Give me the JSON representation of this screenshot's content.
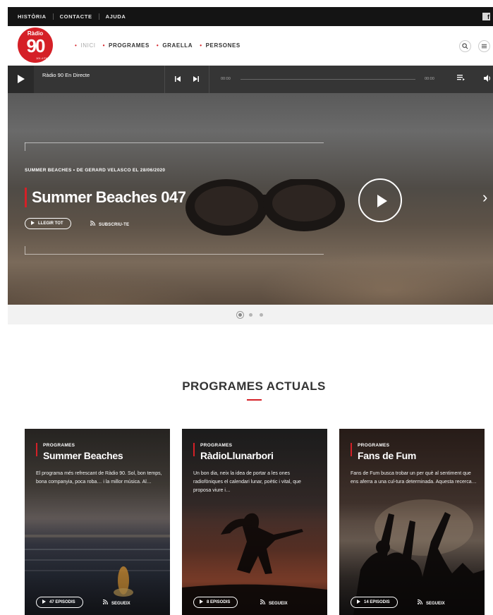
{
  "topbar": {
    "links": [
      "HISTÒRIA",
      "CONTACTE",
      "AJUDA"
    ],
    "social": "f"
  },
  "header": {
    "logo": {
      "top": "Ràdio",
      "number": "90",
      "freq": "101.4 FM"
    },
    "nav": [
      {
        "label": "INICI",
        "active": true
      },
      {
        "label": "PROGRAMES",
        "active": false
      },
      {
        "label": "GRAELLA",
        "active": false
      },
      {
        "label": "PERSONES",
        "active": false
      }
    ],
    "search_icon": "search-icon",
    "menu_icon": "menu-icon"
  },
  "player": {
    "title": "Ràdio 90 En Directe",
    "time_current": "00:00",
    "time_total": "00:00",
    "prev_icon": "⏮",
    "next_icon": "⏭",
    "playlist_icon": "≡",
    "volume_icon": "🔊"
  },
  "hero": {
    "meta": "SUMMER BEACHES • DE GERARD VELASCO EL 28/06/2020",
    "title": "Summer Beaches 047",
    "read_more": "LLEGIR TOT",
    "subscribe": "SUBSCRIU-TE",
    "next_arrow": "›",
    "slides": 3,
    "active_slide": 1
  },
  "section": {
    "title": "PROGRAMES ACTUALS"
  },
  "programs": [
    {
      "category": "PROGRAMES",
      "title": "Summer Beaches",
      "description": "El programa més refrescant de Ràdio 90. Sol, bon temps, bona companyia, poca roba… i la millor música. Al…",
      "episodes": "47 EPISODIS",
      "follow": "SEGUEIX"
    },
    {
      "category": "PROGRAMES",
      "title": "RàdioLlunarbori",
      "description": "Un bon dia, neix la idea de portar a les ones radiofòniques el calendari lunar, poètic i vital, que proposa viure i…",
      "episodes": "8 EPISODIS",
      "follow": "SEGUEIX"
    },
    {
      "category": "PROGRAMES",
      "title": "Fans de Fum",
      "description": "Fans de Fum busca trobar un per què al sentiment que ens aferra a una cul-tura determinada. Aquesta recerca…",
      "episodes": "14 EPISODIS",
      "follow": "SEGUEIX"
    }
  ],
  "colors": {
    "accent": "#d52027",
    "topbar": "#141414",
    "player": "#353535"
  }
}
